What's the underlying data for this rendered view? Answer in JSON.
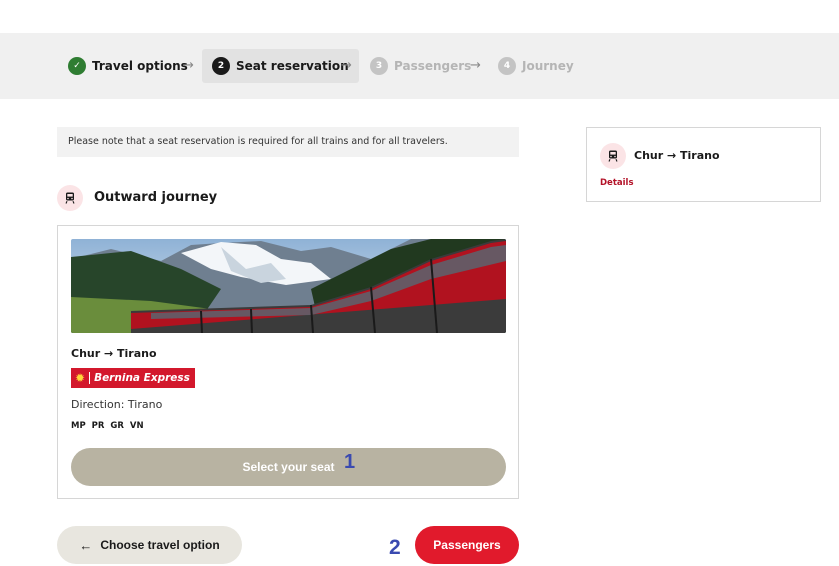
{
  "stepper": {
    "steps": [
      {
        "number": "✓",
        "label": "Travel options",
        "state": "done"
      },
      {
        "number": "2",
        "label": "Seat reservation",
        "state": "active"
      },
      {
        "number": "3",
        "label": "Passengers",
        "state": "future"
      },
      {
        "number": "4",
        "label": "Journey",
        "state": "future"
      }
    ],
    "separator": "→"
  },
  "notice": "Please note that a seat reservation is required for all trains and for all travelers.",
  "outward": {
    "title": "Outward journey",
    "icon": "train-icon"
  },
  "card": {
    "route": "Chur → Tirano",
    "brand_name": "Bernina Express",
    "brand_icon": "sun-icon",
    "direction": "Direction: Tirano",
    "codes": "MP PR GR VN",
    "seat_button": "Select your seat",
    "seat_annotation": "1"
  },
  "footer": {
    "back_arrow": "←",
    "back_label": "Choose travel option",
    "next_annotation": "2",
    "next_label": "Passengers"
  },
  "summary": {
    "route": "Chur → Tirano",
    "details_link": "Details"
  },
  "colors": {
    "accent_red": "#e11a2c",
    "brand_red": "#d3182c",
    "success_green": "#2f7d32",
    "disabled_button": "#b8b3a2",
    "annotation_blue": "#3a4ab0"
  }
}
